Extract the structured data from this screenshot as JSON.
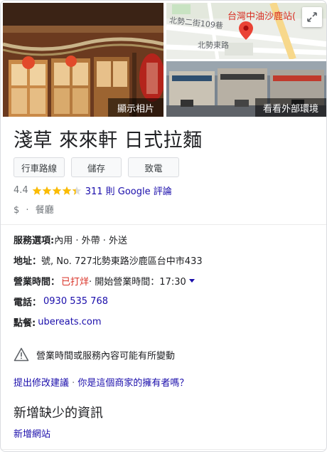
{
  "photos": {
    "main_caption": "顯示相片",
    "street_caption": "看看外部環境",
    "map": {
      "title": "台灣中油沙鹿站(",
      "road_1": "北勢二街109巷",
      "road_2": "北勢東路"
    }
  },
  "business": {
    "name": "淺草 來來軒 日式拉麵"
  },
  "actions": {
    "directions": "行車路線",
    "save": "儲存",
    "call": "致電"
  },
  "rating": {
    "value": "4.4",
    "stars": 4.4,
    "reviews_link": "311 則 Google 評論"
  },
  "category": {
    "price": "$",
    "separator": "·",
    "type": "餐廳"
  },
  "details": {
    "service_label": "服務選項:",
    "service_value": " 內用 · 外帶 · 外送",
    "address_label": "地址：",
    "address_value": " 號, No. 727北勢東路沙鹿區台中市433",
    "hours_label": "營業時間：",
    "hours_status": "已打烊",
    "hours_rest": " · 開始營業時間：17:30",
    "phone_label": "電話：",
    "phone_value": "0930 535 768",
    "order_label": "點餐:",
    "order_value": "ubereats.com"
  },
  "notice": {
    "text": "營業時間或服務內容可能有所變動"
  },
  "suggest": {
    "edit": "提出修改建議",
    "separator": " · ",
    "owner": "你是這個商家的擁有者嗎？"
  },
  "missing": {
    "title": "新增缺少的資訊",
    "add_website": "新增網站"
  },
  "colors": {
    "link": "#1a0dab",
    "closed": "#d93025",
    "star": "#fbbc04",
    "pin": "#ea4335"
  }
}
